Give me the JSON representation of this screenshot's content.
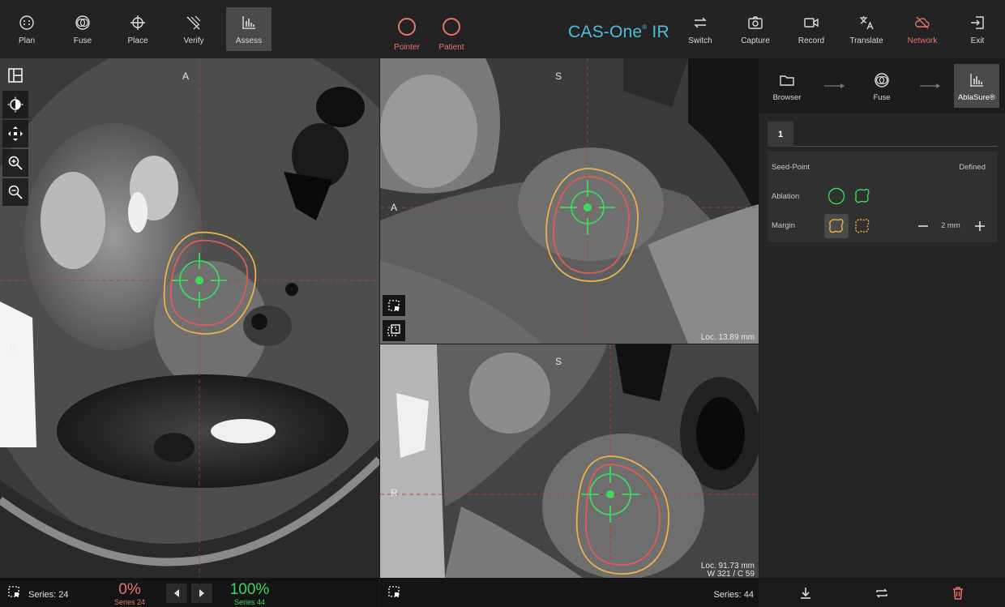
{
  "toolbar": {
    "left_buttons": [
      {
        "label": "Plan",
        "icon": "plan-icon"
      },
      {
        "label": "Fuse",
        "icon": "fuse-icon"
      },
      {
        "label": "Place",
        "icon": "place-crosshair-icon"
      },
      {
        "label": "Verify",
        "icon": "verify-icon"
      },
      {
        "label": "Assess",
        "icon": "assess-chart-icon",
        "active": true
      }
    ],
    "center_buttons": [
      {
        "label": "Pointer"
      },
      {
        "label": "Patient"
      }
    ],
    "brand": {
      "name": "CAS-One",
      "mark": "®",
      "suffix": " IR"
    },
    "right_buttons": [
      {
        "label": "Switch",
        "icon": "switch-arrows-icon"
      },
      {
        "label": "Capture",
        "icon": "camera-icon"
      },
      {
        "label": "Record",
        "icon": "video-icon"
      },
      {
        "label": "Translate",
        "icon": "translate-icon"
      },
      {
        "label": "Network",
        "icon": "cloud-off-icon",
        "status": "warning"
      },
      {
        "label": "Exit",
        "icon": "exit-icon"
      }
    ]
  },
  "views": {
    "axial": {
      "top": "A",
      "left": "R"
    },
    "sagittal": {
      "top": "S",
      "left": "A",
      "loc": "Loc. 13.89 mm"
    },
    "coronal": {
      "top": "S",
      "left": "R",
      "loc": "Loc. 91.73 mm",
      "window": "W 321 / C 59"
    }
  },
  "status": {
    "series_left": "Series: 24",
    "pct_left": "0%",
    "pct_left_series": "Series 24",
    "pct_right": "100%",
    "pct_right_series": "Series 44",
    "series_right": "Series: 44"
  },
  "workflow": {
    "steps": [
      {
        "label": "Browser",
        "icon": "folder-icon"
      },
      {
        "label": "Fuse",
        "icon": "fuse-icon"
      },
      {
        "label": "AblaSure®",
        "icon": "assess-chart-icon",
        "active": true
      }
    ]
  },
  "panel": {
    "tab": "1",
    "seed_label": "Seed-Point",
    "seed_value": "Defined",
    "ablation_label": "Ablation",
    "margin_label": "Margin",
    "margin_value": "2 mm"
  },
  "colors": {
    "accent": "#4cc0d9",
    "warning": "#e8756a",
    "ablation_contour": "#e05a5a",
    "margin_contour": "#e8b44a",
    "seed_marker": "#3ed860"
  }
}
